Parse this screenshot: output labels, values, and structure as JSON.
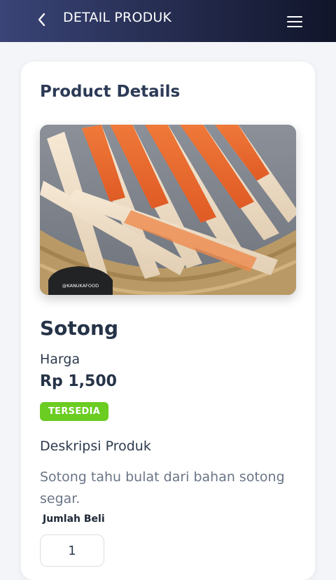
{
  "header": {
    "title": "DETAIL PRODUK",
    "back_icon": "chevron-left-icon",
    "menu_icon": "hamburger-menu-icon"
  },
  "product": {
    "section_title": "Product Details",
    "image_watermark": "@KANUKAFOOD",
    "name": "Sotong",
    "price_label": "Harga",
    "price": "Rp 1,500",
    "status": "TERSEDIA",
    "status_color": "#6bcc21",
    "description_title": "Deskripsi Produk",
    "description": "Sotong tahu bulat dari bahan sotong segar.",
    "quantity_label": "Jumlah Beli",
    "quantity": "1"
  },
  "colors": {
    "header_start": "#3a4577",
    "header_end": "#11152a",
    "background": "#f3f5f8"
  }
}
